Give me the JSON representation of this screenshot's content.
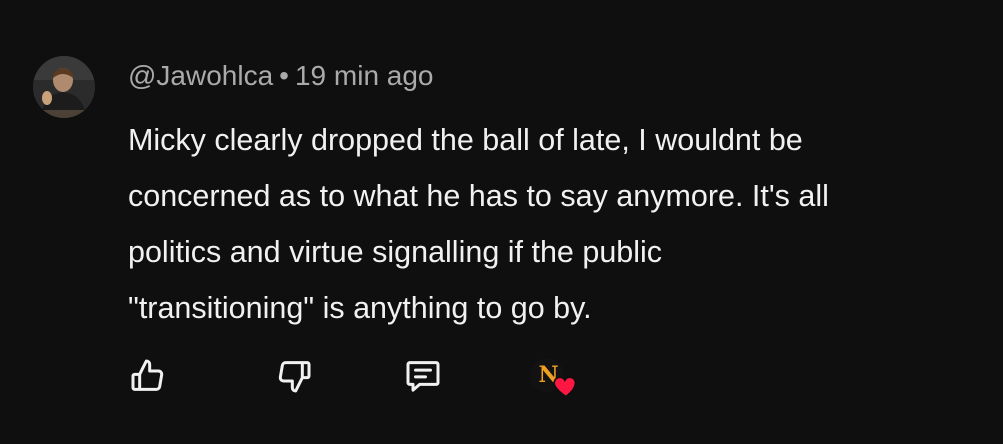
{
  "comment": {
    "author": "@Jawohlca",
    "separator": "•",
    "time": "19 min ago",
    "text_lines": [
      "Micky clearly dropped the ball of late, I wouldnt be",
      "concerned as to what he has to say anymore. It's all",
      "politics and virtue signalling if the public",
      "\"transitioning\" is anything to go by."
    ]
  },
  "actions": {
    "like_icon": "thumb-up-icon",
    "dislike_icon": "thumb-down-icon",
    "reply_icon": "comment-reply-icon",
    "creator_heart_icon": "heart-icon",
    "creator_avatar_text": "N"
  },
  "colors": {
    "background": "#0f0f0f",
    "text": "#f1f1f1",
    "meta": "#aaaaaa",
    "heart": "#ff1744",
    "creator_mark": "#f0a020"
  }
}
